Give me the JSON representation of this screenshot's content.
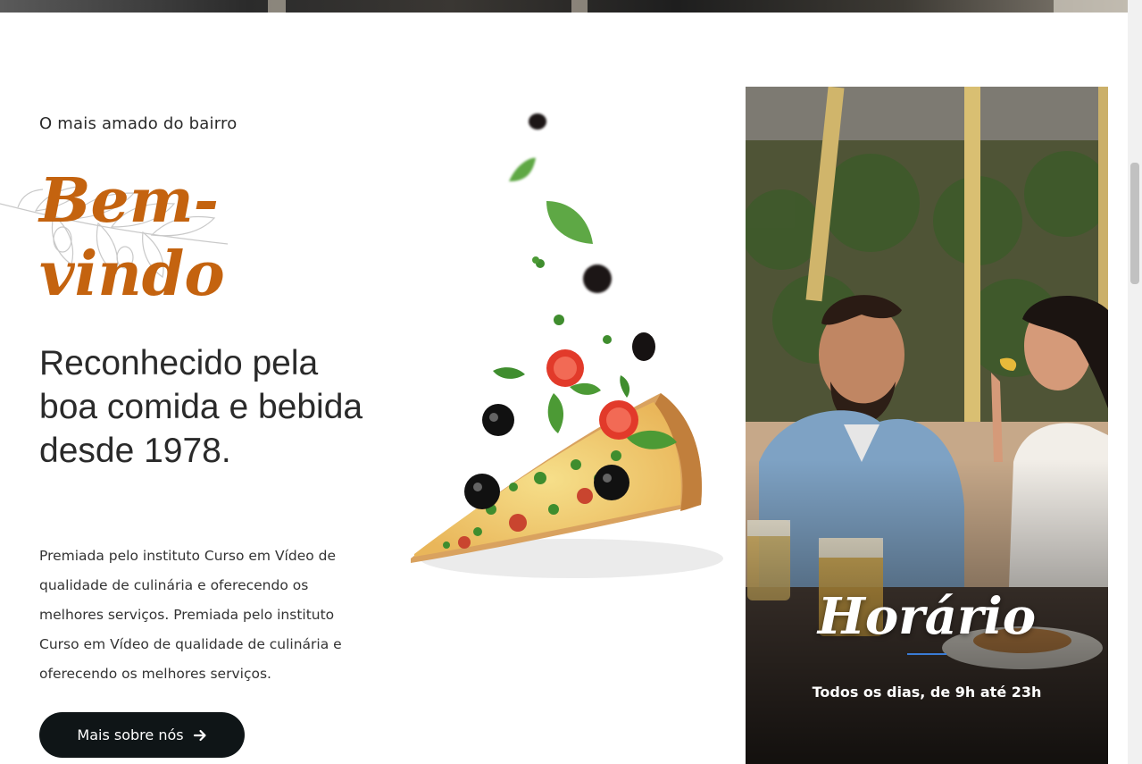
{
  "intro": {
    "eyebrow": "O mais amado do bairro",
    "welcome_line1": "Bem-",
    "welcome_line2": "vindo",
    "headline": "Reconhecido pela boa comida e bebida desde 1978.",
    "body": "Premiada pelo instituto Curso em Vídeo de qualidade de culinária e oferecendo os melhores serviços. Premiada pelo instituto Curso em Vídeo de qualidade de culinária e oferecendo os melhores serviços.",
    "cta_label": "Mais sobre nós"
  },
  "hours": {
    "title": "Horário",
    "text": "Todos os dias, de 9h até 23h"
  },
  "icons": {
    "cta": "arrow-right-icon",
    "decor": "olive-branch-icon"
  },
  "colors": {
    "accent": "#c4630f",
    "button_bg": "#0f1517",
    "divider": "#3a7bd5"
  }
}
